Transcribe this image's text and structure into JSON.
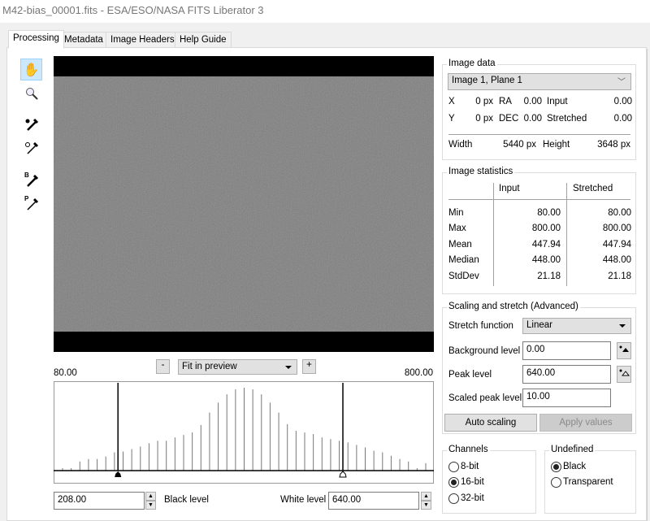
{
  "window": {
    "title": "M42-bias_00001.fits - ESA/ESO/NASA FITS Liberator 3"
  },
  "tabs": [
    {
      "label": "Processing",
      "active": true
    },
    {
      "label": "Metadata",
      "active": false
    },
    {
      "label": "Image Headers",
      "active": false
    },
    {
      "label": "Help Guide",
      "active": false
    }
  ],
  "tools": [
    "hand-icon",
    "zoom-icon",
    "background-picker-icon",
    "peak-picker-icon",
    "black-picker-icon",
    "white-picker-icon"
  ],
  "tool_letters": {
    "black": "B",
    "peak": "P"
  },
  "preview": {
    "zoom_out": "-",
    "zoom_in": "+",
    "zoom_mode": "Fit in preview",
    "range_min": "80.00",
    "range_max": "800.00"
  },
  "chart_data": {
    "type": "bar",
    "title": "",
    "xlim": [
      80,
      800
    ],
    "values_relative": [
      3,
      3,
      11,
      14,
      14,
      17,
      22,
      23,
      26,
      29,
      33,
      36,
      36,
      40,
      43,
      46,
      55,
      70,
      82,
      92,
      98,
      100,
      98,
      92,
      82,
      70,
      56,
      48,
      46,
      44,
      40,
      38,
      36,
      34,
      31,
      28,
      24,
      22,
      18,
      14,
      11,
      3,
      9
    ],
    "black_level": 208,
    "white_level": 640
  },
  "levels": {
    "black_value": "208.00",
    "black_label": "Black level",
    "white_value": "640.00",
    "white_label": "White level"
  },
  "image_data": {
    "title": "Image data",
    "plane": "Image 1, Plane 1",
    "x_label": "X",
    "x_value": "0 px",
    "ra_label": "RA",
    "ra_value": "0.00",
    "input_label": "Input",
    "input_value": "0.00",
    "y_label": "Y",
    "y_value": "0 px",
    "dec_label": "DEC",
    "dec_value": "0.00",
    "stretched_label": "Stretched",
    "stretched_value": "0.00",
    "width_label": "Width",
    "width_value": "5440 px",
    "height_label": "Height",
    "height_value": "3648 px"
  },
  "statistics": {
    "title": "Image statistics",
    "col_input": "Input",
    "col_stretched": "Stretched",
    "rows": [
      {
        "label": "Min",
        "input": "80.00",
        "stretched": "80.00"
      },
      {
        "label": "Max",
        "input": "800.00",
        "stretched": "800.00"
      },
      {
        "label": "Mean",
        "input": "447.94",
        "stretched": "447.94"
      },
      {
        "label": "Median",
        "input": "448.00",
        "stretched": "448.00"
      },
      {
        "label": "StdDev",
        "input": "21.18",
        "stretched": "21.18"
      }
    ]
  },
  "scaling": {
    "title": "Scaling and stretch (Advanced)",
    "stretch_label": "Stretch function",
    "stretch_value": "Linear",
    "background_label": "Background level",
    "background_value": "0.00",
    "peak_label": "Peak level",
    "peak_value": "640.00",
    "scaled_peak_label": "Scaled peak level",
    "scaled_peak_value": "10.00",
    "auto_button": "Auto scaling",
    "apply_button": "Apply values"
  },
  "channels": {
    "title": "Channels",
    "options": [
      "8-bit",
      "16-bit",
      "32-bit"
    ],
    "selected": "16-bit"
  },
  "undefined": {
    "title": "Undefined",
    "options": [
      "Black",
      "Transparent"
    ],
    "selected": "Black"
  }
}
